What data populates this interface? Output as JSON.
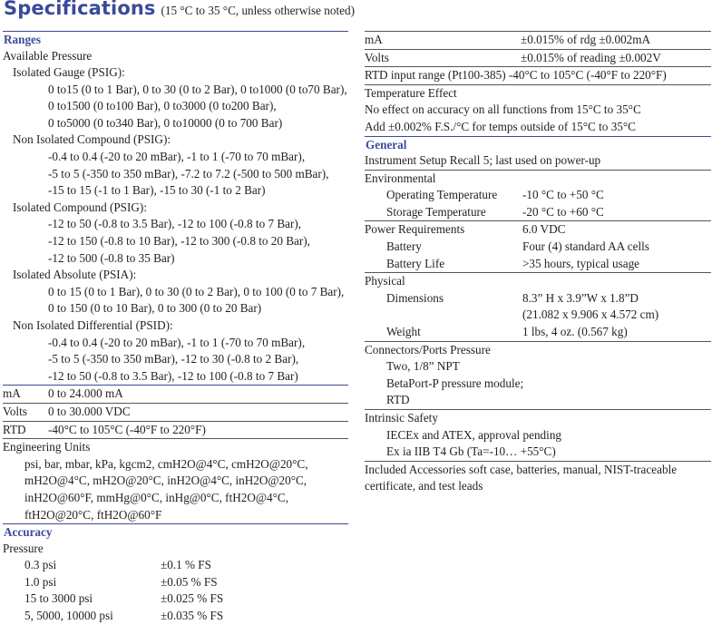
{
  "title": "Specifications",
  "subtitle": "(15 °C to 35 °C, unless otherwise noted)",
  "left": {
    "ranges_header": "Ranges",
    "available_pressure": "Available Pressure",
    "isolated_gauge": {
      "label": "Isolated Gauge (PSIG):",
      "lines": [
        "0 to15 (0 to 1 Bar), 0 to 30 (0 to 2 Bar), 0 to1000 (0 to70 Bar),",
        "0 to1500 (0 to100 Bar), 0 to3000 (0 to200 Bar),",
        "0 to5000 (0 to340 Bar), 0 to10000 (0 to 700 Bar)"
      ]
    },
    "non_isolated_compound": {
      "label": "Non Isolated Compound (PSIG):",
      "lines": [
        "-0.4 to 0.4 (-20 to 20 mBar), -1 to 1 (-70 to 70 mBar),",
        "-5 to 5 (-350 to 350 mBar), -7.2 to 7.2 (-500 to 500 mBar),",
        "-15 to 15 (-1 to 1 Bar), -15 to 30 (-1 to 2 Bar)"
      ]
    },
    "isolated_compound": {
      "label": "Isolated Compound (PSIG):",
      "lines": [
        "-12 to 50 (-0.8 to 3.5 Bar), -12 to 100 (-0.8 to 7 Bar),",
        "-12 to 150 (-0.8 to 10 Bar), -12 to 300 (-0.8 to 20 Bar),",
        "-12 to 500 (-0.8 to 35 Bar)"
      ]
    },
    "isolated_absolute": {
      "label": "Isolated Absolute (PSIA):",
      "lines": [
        "0 to 15 (0 to 1 Bar), 0 to 30 (0 to 2 Bar), 0 to 100 (0 to 7 Bar),",
        "0 to 150 (0 to 10 Bar), 0 to 300 (0 to 20 Bar)"
      ]
    },
    "non_isolated_differential": {
      "label": "Non Isolated Differential (PSID):",
      "lines": [
        "-0.4 to 0.4 (-20 to 20 mBar), -1 to 1 (-70 to 70 mBar),",
        "-5 to 5 (-350 to 350 mBar), -12 to 30 (-0.8 to 2 Bar),",
        "-12 to 50 (-0.8 to 3.5 Bar), -12 to 100 (-0.8 to 7 Bar)"
      ]
    },
    "ma": {
      "label": "mA",
      "value": "0 to 24.000 mA"
    },
    "volts": {
      "label": "Volts",
      "value": "0 to 30.000 VDC"
    },
    "rtd": {
      "label": "RTD",
      "value": "-40°C to 105°C (-40°F to 220°F)"
    },
    "engineering_units": {
      "label": "Engineering Units",
      "lines": [
        "psi, bar, mbar, kPa, kgcm2, cmH2O@4°C, cmH2O@20°C,",
        "mH2O@4°C, mH2O@20°C, inH2O@4°C, inH2O@20°C,",
        "inH2O@60°F, mmHg@0°C, inHg@0°C, ftH2O@4°C,",
        "ftH2O@20°C, ftH2O@60°F"
      ]
    },
    "accuracy_header": "Accuracy",
    "pressure_label": "Pressure",
    "pressure_rows": [
      {
        "range": "0.3 psi",
        "value": "±0.1 % FS"
      },
      {
        "range": "1.0 psi",
        "value": "±0.05 % FS"
      },
      {
        "range": "15 to 3000 psi",
        "value": "±0.025 % FS"
      },
      {
        "range": "5, 5000, 10000 psi",
        "value": "±0.035 % FS"
      }
    ]
  },
  "right": {
    "ma": {
      "label": "mA",
      "value": "±0.015% of rdg ±0.002mA"
    },
    "volts": {
      "label": "Volts",
      "value": "±0.015% of reading ±0.002V"
    },
    "rtd_input": "RTD input range (Pt100-385) -40°C to 105°C (-40°F to 220°F)",
    "temp_effect": {
      "label": "Temperature Effect",
      "lines": [
        "No effect on accuracy on all functions from 15°C to 35°C",
        "Add ±0.002% F.S./°C for temps outside of 15°C to 35°C"
      ]
    },
    "general_header": "General",
    "setup_recall": "Instrument Setup Recall  5; last used on power-up",
    "environmental": {
      "label": "Environmental",
      "rows": [
        {
          "label": "Operating Temperature",
          "value": "-10 °C to +50 °C"
        },
        {
          "label": "Storage Temperature",
          "value": "-20 °C to +60 °C"
        }
      ]
    },
    "power": {
      "label": "Power Requirements",
      "value": "6.0 VDC",
      "rows": [
        {
          "label": "Battery",
          "value": "Four (4) standard AA cells"
        },
        {
          "label": "Battery Life",
          "value": ">35 hours, typical usage"
        }
      ]
    },
    "physical": {
      "label": "Physical",
      "dimensions_label": "Dimensions",
      "dimensions_value_1": "8.3” H x 3.9”W x 1.8”D",
      "dimensions_value_2": "(21.082 x 9.906 x 4.572 cm)",
      "weight_label": "Weight",
      "weight_value": "1 lbs, 4 oz. (0.567 kg)"
    },
    "connectors": {
      "label": "Connectors/Ports Pressure",
      "lines": [
        "Two, 1/8” NPT",
        "BetaPort-P pressure module;",
        "RTD"
      ]
    },
    "intrinsic_safety": {
      "label": "Intrinsic Safety",
      "lines": [
        "IECEx and ATEX, approval pending",
        "Ex ia IIB T4 Gb (Ta=-10… +55°C)"
      ]
    },
    "accessories": {
      "line1": "Included Accessories soft case, batteries, manual, NIST-traceable",
      "line2": "certificate, and test leads"
    }
  }
}
